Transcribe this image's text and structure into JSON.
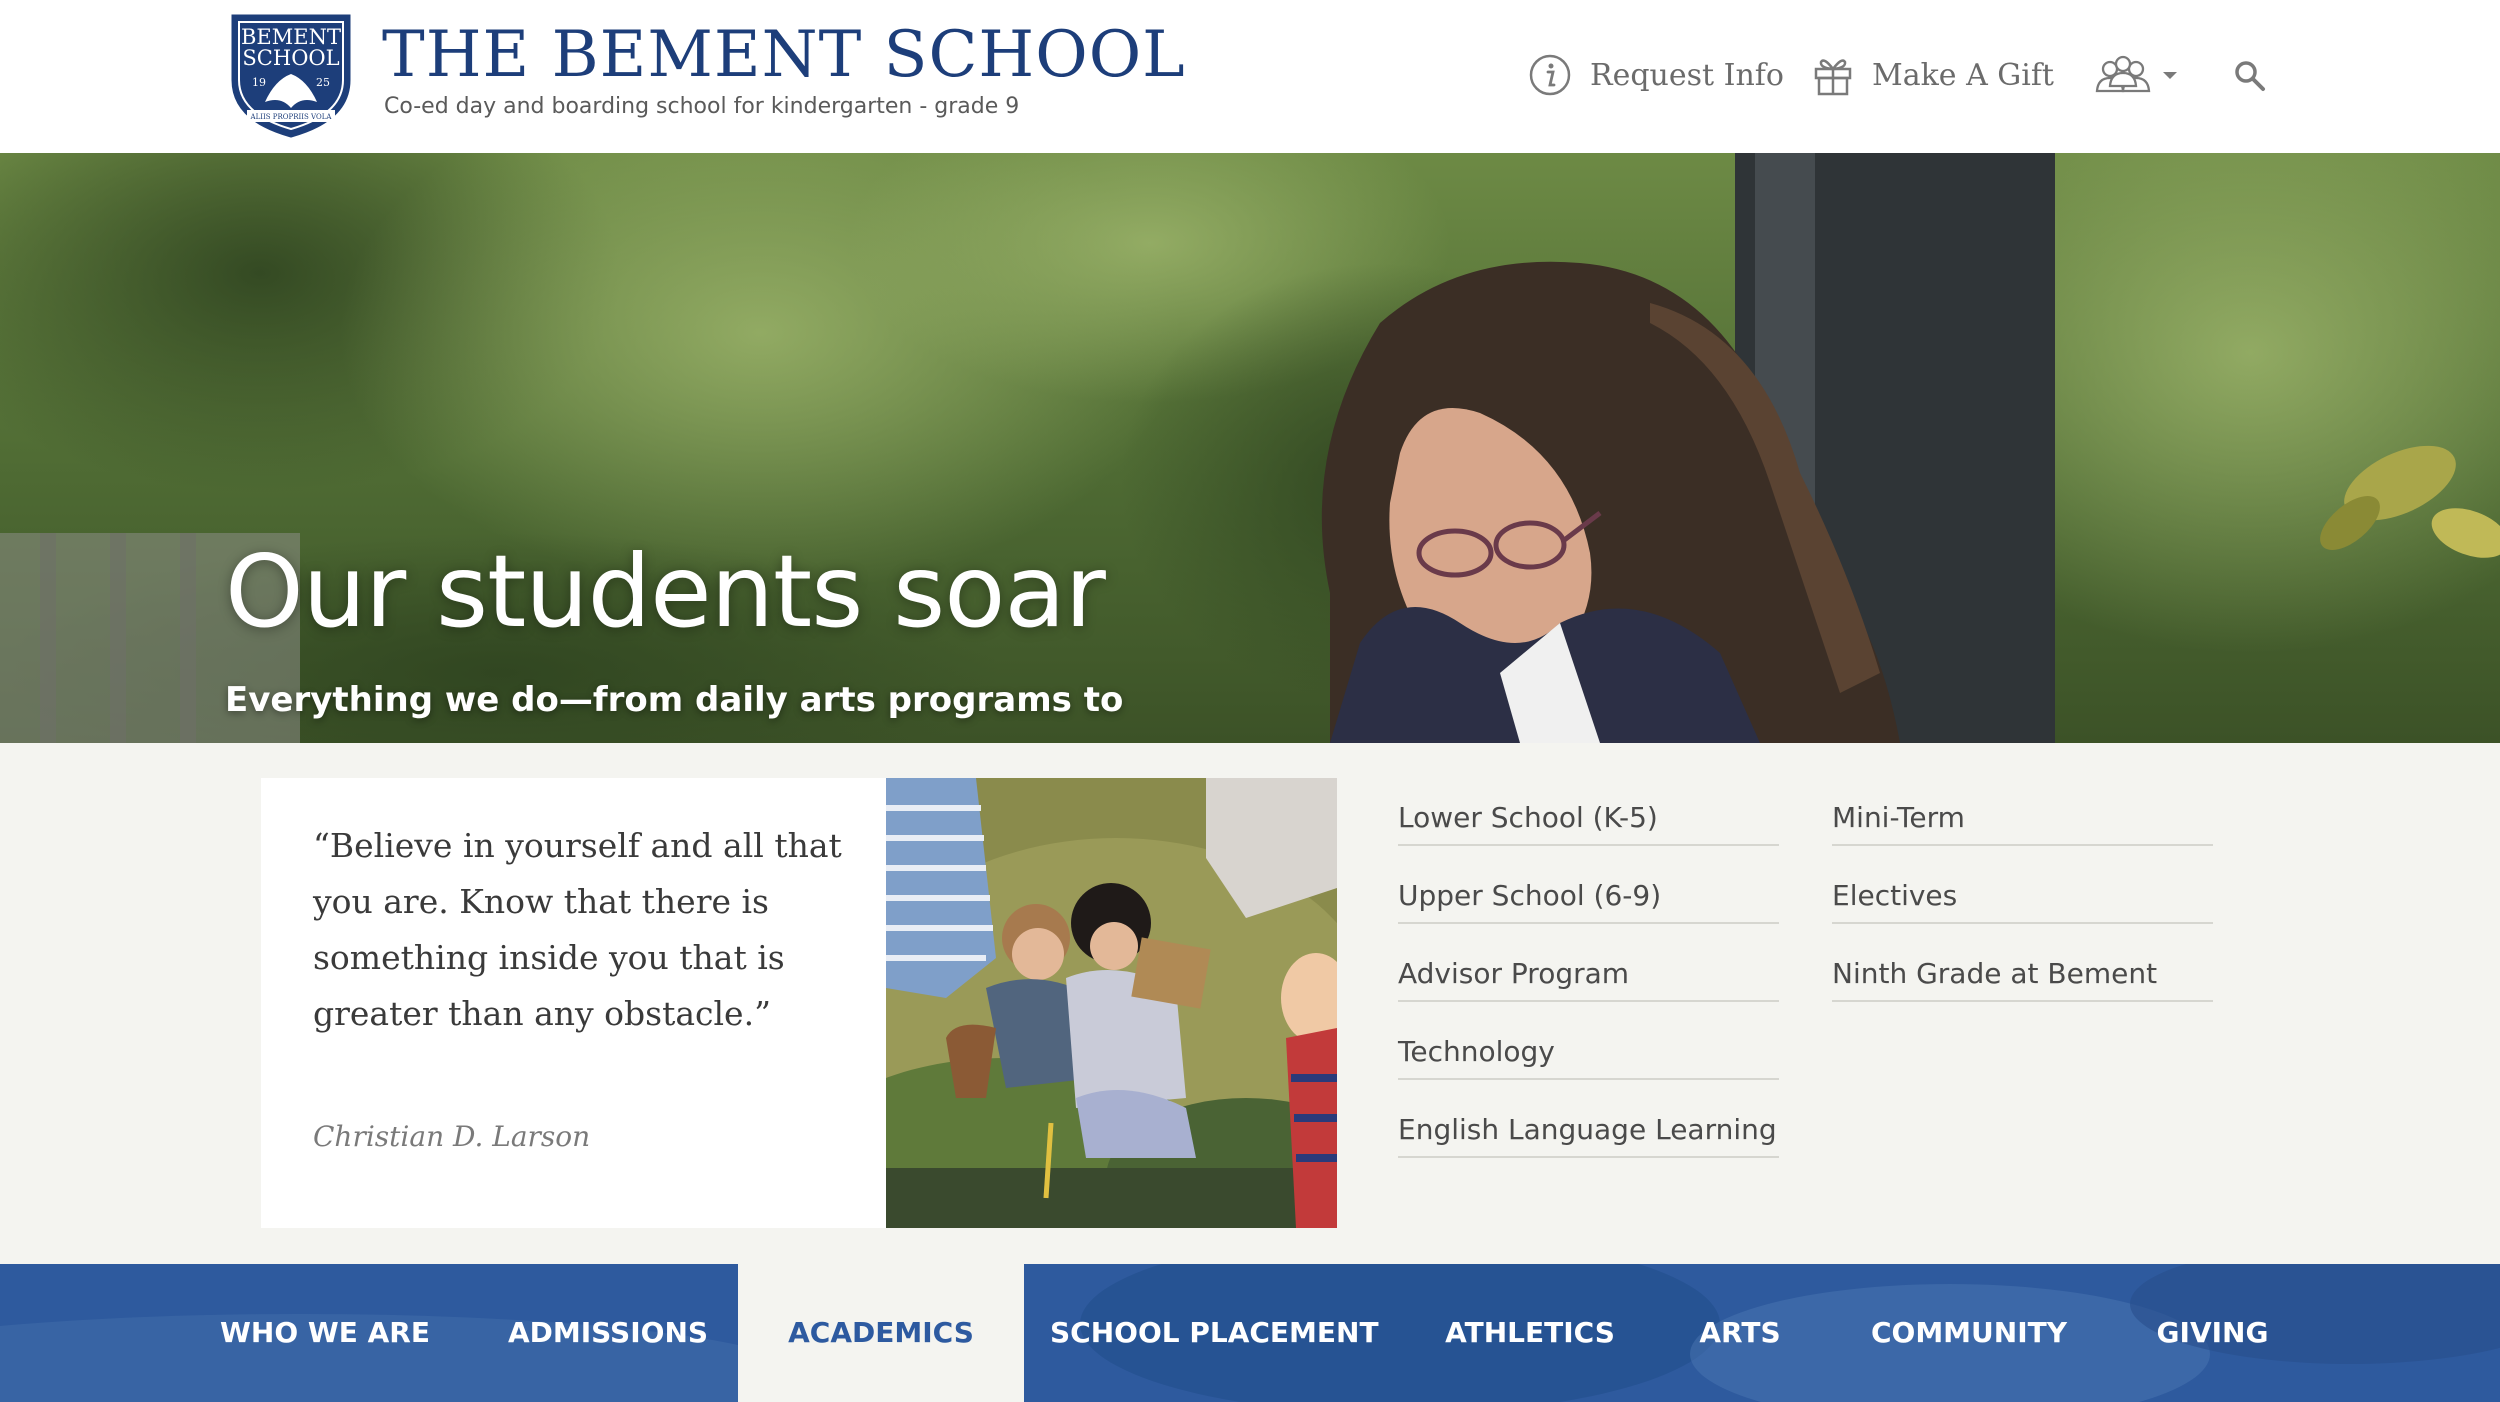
{
  "header": {
    "crest": {
      "line1": "BEMENT",
      "line2": "SCHOOL",
      "year_left": "19",
      "year_right": "25",
      "motto": "ALIIS PROPRIIS VOLA"
    },
    "title": "THE BEMENT SCHOOL",
    "tagline": "Co-ed day and boarding school for kindergarten - grade 9",
    "utility": {
      "request_info": "Request Info",
      "make_a_gift": "Make A Gift"
    }
  },
  "hero": {
    "heading": "Our students soar",
    "subheading": "Everything we do—from daily arts programs to"
  },
  "quote": {
    "text": "“Believe in yourself and all that you are. Know that there is something inside you that is greater than any obstacle.”",
    "author": "Christian D. Larson"
  },
  "academics_links": {
    "column1": [
      "Lower School (K-5)",
      "Upper School (6-9)",
      "Advisor Program",
      "Technology",
      "English Language Learning"
    ],
    "column2": [
      "Mini-Term",
      "Electives",
      "Ninth Grade at Bement"
    ]
  },
  "nav": {
    "items": [
      "WHO WE ARE",
      "ADMISSIONS",
      "ACADEMICS",
      "SCHOOL PLACEMENT",
      "ATHLETICS",
      "ARTS",
      "COMMUNITY",
      "GIVING"
    ],
    "active": "ACADEMICS"
  },
  "colors": {
    "brand_navy": "#1d3e7a",
    "nav_blue": "#2d5aa0",
    "content_bg": "#f4f4f0"
  },
  "icons": [
    "info-icon",
    "gift-icon",
    "people-icon",
    "chevron-down-icon",
    "search-icon"
  ]
}
